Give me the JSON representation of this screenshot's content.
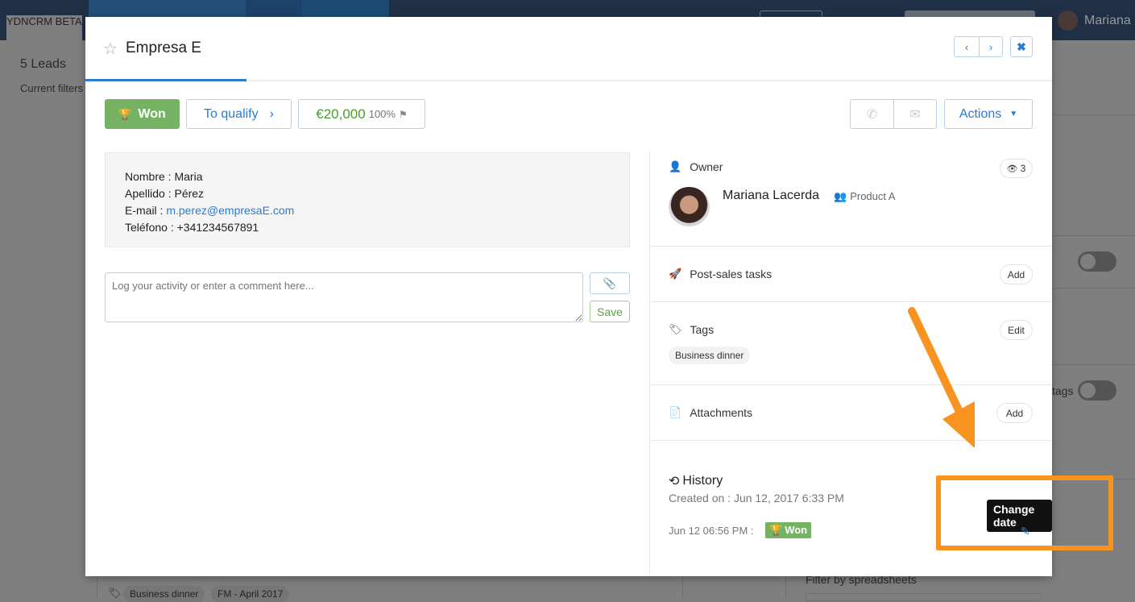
{
  "background": {
    "brand": "YDNCRM BETA",
    "user_name": "Mariana",
    "leads_count": "5 Leads",
    "current_filters": "Current filters",
    "tags_label": "tags",
    "filter_spreadsheets": "Filter by spreadsheets",
    "row_tags": [
      "Business dinner",
      "FM - April 2017"
    ]
  },
  "modal": {
    "title": "Empresa E",
    "status_button": "Won",
    "stage_button": "To qualify",
    "amount": "€20,000",
    "probability": "100%",
    "actions_button": "Actions",
    "contact": [
      {
        "label": "Nombre : ",
        "value": "Maria"
      },
      {
        "label": "Apellido : ",
        "value": "Pérez"
      },
      {
        "label": "E-mail : ",
        "value": "m.perez@empresaE.com",
        "link": true
      },
      {
        "label": "Teléfono : ",
        "value": "+341234567891"
      }
    ],
    "comment_placeholder": "Log your activity or enter a comment here...",
    "save_button": "Save",
    "owner": {
      "label": "Owner",
      "name": "Mariana Lacerda",
      "team": "Product A",
      "watchers": "3"
    },
    "post_sales": {
      "label": "Post-sales tasks",
      "button": "Add"
    },
    "tags": {
      "label": "Tags",
      "button": "Edit",
      "items": [
        "Business dinner"
      ]
    },
    "attachments": {
      "label": "Attachments",
      "button": "Add"
    },
    "history": {
      "label": "History",
      "created": "Created on : Jun 12, 2017 6:33 PM",
      "entry_date": "Jun 12 06:56 PM :",
      "entry_status": "Won",
      "tooltip": "Change date"
    }
  },
  "colors": {
    "won_green": "#75b263",
    "link_blue": "#2b7bd0",
    "annotation_orange": "#f7931e",
    "amount_green": "#4a9a2e"
  }
}
